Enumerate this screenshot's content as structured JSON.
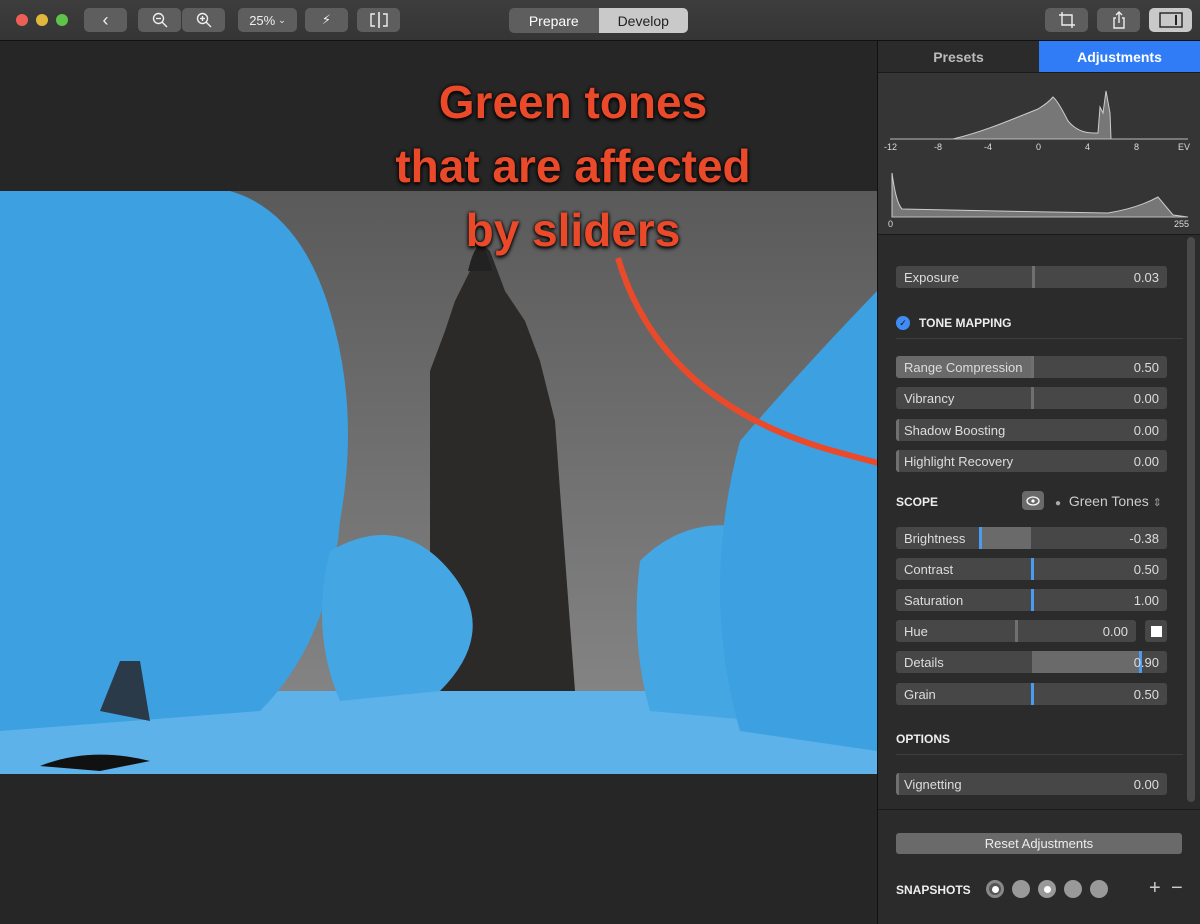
{
  "toolbar": {
    "zoom_label": "25%",
    "modes": [
      {
        "label": "Prepare",
        "active": false
      },
      {
        "label": "Develop",
        "active": true
      }
    ],
    "icons": [
      "back-icon",
      "zoom-out-icon",
      "zoom-in-icon",
      "auto-enhance-icon",
      "compare-icon",
      "crop-icon",
      "share-icon",
      "sidebar-toggle-icon"
    ]
  },
  "annotation": {
    "lines": [
      "Green tones",
      "that are affected",
      "by sliders"
    ],
    "color": "#ea4a2a"
  },
  "sidebar": {
    "tabs": [
      {
        "label": "Presets",
        "active": false
      },
      {
        "label": "Adjustments",
        "active": true
      }
    ],
    "accent": "#2f7cf6",
    "histogram": {
      "ev_ticks": [
        "-12",
        "-8",
        "-4",
        "0",
        "4",
        "8",
        "EV"
      ],
      "lum_ticks": [
        "0",
        "255"
      ]
    },
    "exposure": {
      "label": "Exposure",
      "value": "0.03",
      "min": -4,
      "max": 4,
      "v": 0.03,
      "origin": 0,
      "marker": "gray"
    },
    "tone_mapping": {
      "title": "TONE MAPPING",
      "enabled": true,
      "sliders": [
        {
          "label": "Range Compression",
          "value": "0.50",
          "min": 0,
          "max": 1,
          "v": 0.5,
          "origin": 0,
          "marker": "gray"
        },
        {
          "label": "Vibrancy",
          "value": "0.00",
          "min": -1,
          "max": 1,
          "v": 0,
          "origin": 0,
          "marker": "gray"
        },
        {
          "label": "Shadow Boosting",
          "value": "0.00",
          "min": 0,
          "max": 1,
          "v": 0,
          "origin": 0,
          "marker": "gray"
        },
        {
          "label": "Highlight Recovery",
          "value": "0.00",
          "min": 0,
          "max": 1,
          "v": 0,
          "origin": 0,
          "marker": "gray"
        }
      ]
    },
    "scope": {
      "title": "SCOPE",
      "selection": "Green Tones",
      "sliders": [
        {
          "label": "Brightness",
          "value": "-0.38",
          "min": -1,
          "max": 1,
          "v": -0.38,
          "origin": 0,
          "marker": "blue"
        },
        {
          "label": "Contrast",
          "value": "0.50",
          "min": 0,
          "max": 1,
          "v": 0.5,
          "origin": 0.5,
          "marker": "blue"
        },
        {
          "label": "Saturation",
          "value": "1.00",
          "min": 0,
          "max": 2,
          "v": 1,
          "origin": 1,
          "marker": "blue"
        },
        {
          "label": "Hue",
          "value": "0.00",
          "min": -1,
          "max": 1,
          "v": 0,
          "origin": 0,
          "marker": "gray"
        },
        {
          "label": "Details",
          "value": "0.90",
          "min": 0,
          "max": 1,
          "v": 0.9,
          "origin": 0.5,
          "marker": "blue"
        },
        {
          "label": "Grain",
          "value": "0.50",
          "min": 0,
          "max": 1,
          "v": 0.5,
          "origin": 0.5,
          "marker": "blue"
        }
      ]
    },
    "options": {
      "title": "OPTIONS",
      "sliders": [
        {
          "label": "Vignetting",
          "value": "0.00",
          "min": 0,
          "max": 1,
          "v": 0,
          "origin": 0,
          "marker": "gray"
        }
      ]
    },
    "reset_label": "Reset Adjustments",
    "snapshots": {
      "title": "SNAPSHOTS",
      "count": 5,
      "filled": [
        0,
        2
      ],
      "add": "+",
      "remove": "−"
    }
  }
}
